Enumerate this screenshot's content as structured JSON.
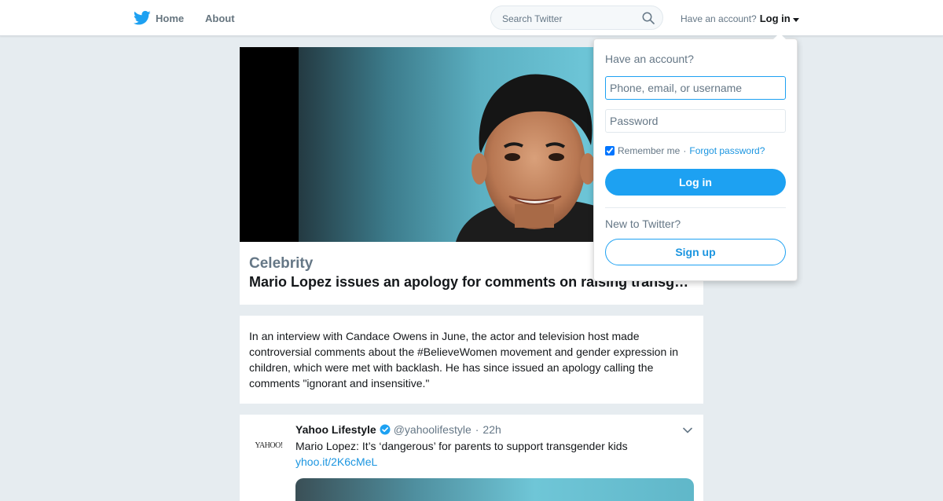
{
  "nav": {
    "home_label": "Home",
    "about_label": "About",
    "search_placeholder": "Search Twitter",
    "account_prompt": "Have an account?",
    "login_label": "Log in"
  },
  "hero": {
    "category": "Celebrity",
    "title": "Mario Lopez issues an apology for comments on raising transgender kids"
  },
  "summary": {
    "text": "In an interview with Candace Owens in June, the actor and television host made controversial comments about the #BelieveWomen movement and gender expression in children, which were met with backlash. He has since issued an apology calling the comments \"ignorant and insensitive.\""
  },
  "tweet": {
    "avatar_text": "YAHOO!",
    "name": "Yahoo Lifestyle",
    "handle": "@yahoolifestyle",
    "separator": "·",
    "time": "22h",
    "text": "Mario Lopez: It’s ‘dangerous’ for parents to support transgender kids",
    "link": "yhoo.it/2K6cMeL"
  },
  "login_dropdown": {
    "heading": "Have an account?",
    "username_placeholder": "Phone, email, or username",
    "password_placeholder": "Password",
    "remember_label": "Remember me",
    "separator": "·",
    "forgot_label": "Forgot password?",
    "remember_checked": true,
    "login_button": "Log in",
    "new_prompt": "New to Twitter?",
    "signup_button": "Sign up"
  },
  "colors": {
    "brand_blue": "#1da1f2",
    "link_blue": "#1b95e0",
    "page_background": "#e6ecf0"
  },
  "icons": [
    "twitter-bird-icon",
    "search-icon",
    "caret-down-icon",
    "verified-badge-icon",
    "chevron-down-icon"
  ]
}
